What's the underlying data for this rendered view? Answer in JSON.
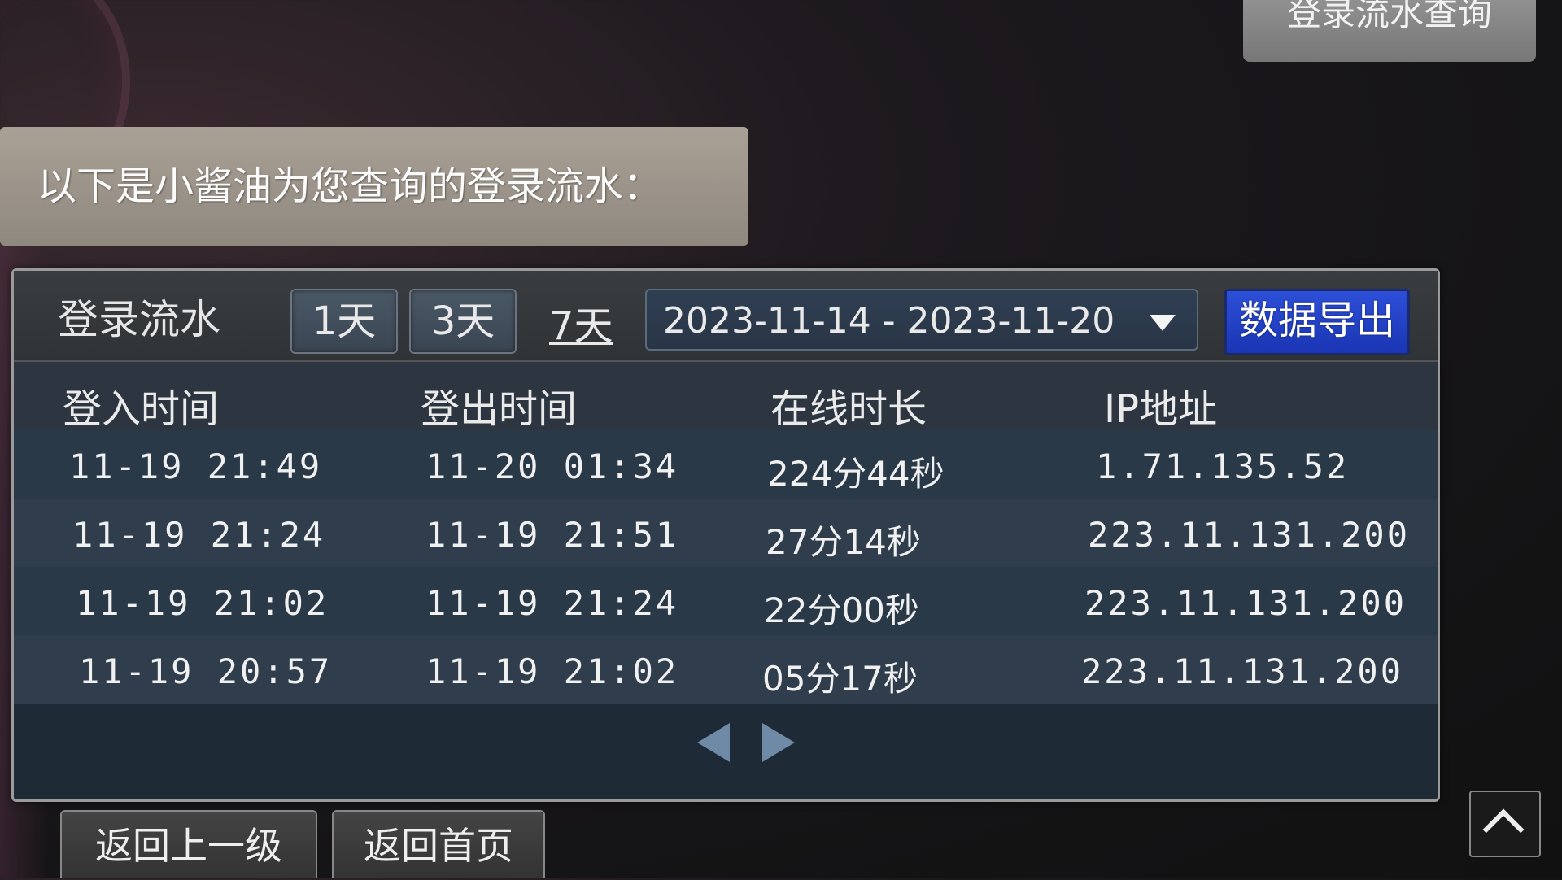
{
  "header": {
    "tab_label": "登录流水查询"
  },
  "notice": {
    "text": "以下是小酱油为您查询的登录流水："
  },
  "toolbar": {
    "title": "登录流水",
    "btn_1day": "1天",
    "btn_3day": "3天",
    "link_7day": "7天",
    "date_range": "2023-11-14 - 2023-11-20",
    "export_label": "数据导出"
  },
  "table": {
    "headers": [
      "登入时间",
      "登出时间",
      "在线时长",
      "IP地址"
    ],
    "rows": [
      [
        "11-19 21:49",
        "11-20 01:34",
        "224分44秒",
        "1.71.135.52"
      ],
      [
        "11-19 21:24",
        "11-19 21:51",
        "27分14秒",
        "223.11.131.200"
      ],
      [
        "11-19 21:02",
        "11-19 21:24",
        "22分00秒",
        "223.11.131.200"
      ],
      [
        "11-19 20:57",
        "11-19 21:02",
        "05分17秒",
        "223.11.131.200"
      ]
    ]
  },
  "footer": {
    "back_label": "返回上一级",
    "home_label": "返回首页"
  },
  "icons": {
    "prev": "triangle-left-icon",
    "next": "triangle-right-icon",
    "dropdown": "caret-down-icon",
    "scroll_top": "chevron-up-icon"
  },
  "colors": {
    "export_button": "#2340c8",
    "panel_bg": "#1e2a36",
    "notice_bg": "#a39b90"
  }
}
